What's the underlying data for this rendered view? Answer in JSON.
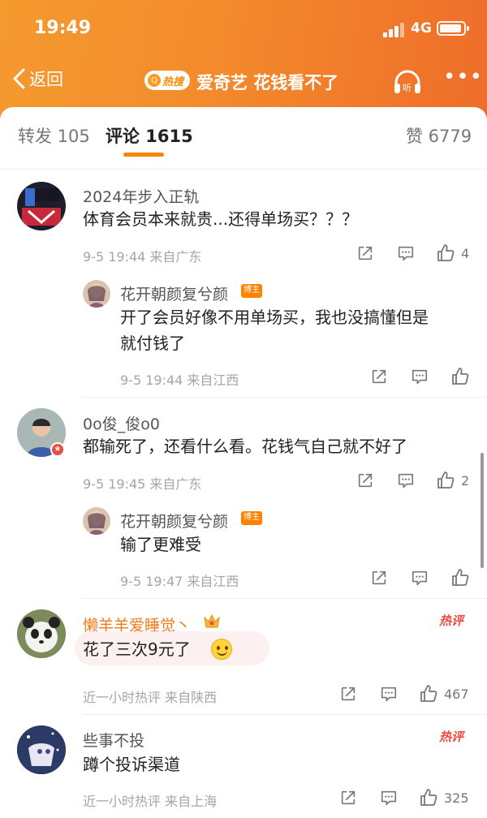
{
  "status_bar": {
    "time": "19:49",
    "network": "4G"
  },
  "nav": {
    "back_label": "返回",
    "hot_tag": "热搜",
    "title": "爱奇艺 花钱看不了"
  },
  "tabs": {
    "repost": "转发 105",
    "comments": "评论 1615",
    "likes": "赞 6779"
  },
  "comments": [
    {
      "user": "2024年步入正轨",
      "text": "体育会员本来就贵...还得单场买？？？",
      "meta": "9-5 19:44  来自广东",
      "like_count": "4",
      "reply": {
        "user": "花开朝颜复兮颜",
        "badge": "博主",
        "text_line1": "开了会员好像不用单场买，我也没搞懂但是",
        "text_line2": "就付钱了",
        "meta": "9-5 19:44  来自江西"
      }
    },
    {
      "user": "0o俊_俊o0",
      "text": "都输死了，还看什么看。花钱气自己就不好了",
      "meta": "9-5 19:45  来自广东",
      "like_count": "2",
      "reply": {
        "user": "花开朝颜复兮颜",
        "badge": "博主",
        "text": "输了更难受",
        "meta": "9-5 19:47  来自江西"
      }
    },
    {
      "user": "懒羊羊爱睡觉丶",
      "hot_label": "热评",
      "text": "花了三次9元了",
      "meta": "近一小时热评  来自陕西",
      "like_count": "467"
    },
    {
      "user": "些事不投",
      "hot_label": "热评",
      "text": "蹲个投诉渠道",
      "meta": "近一小时热评  来自上海",
      "like_count": "325"
    }
  ],
  "icons": [
    "chevron-left-icon",
    "search-icon",
    "headphones-icon",
    "more-icon",
    "share-icon",
    "comment-icon",
    "thumbs-up-icon",
    "smile-emoji-icon",
    "crown-icon"
  ],
  "colors": {
    "accent": "#ff8200",
    "header_start": "#f59a2f",
    "header_end": "#ee6d2a",
    "hot": "#f04a3c",
    "vip_name": "#f27a1a"
  }
}
